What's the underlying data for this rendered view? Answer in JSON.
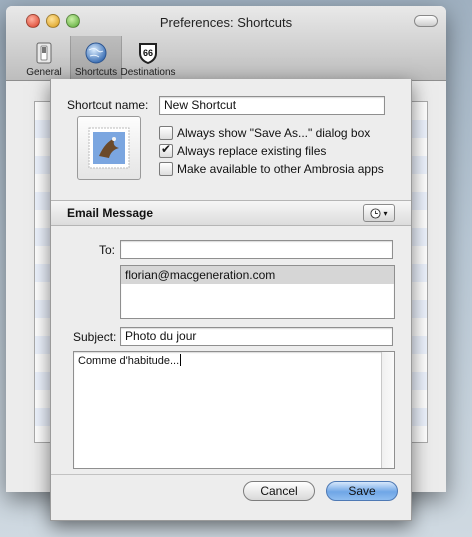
{
  "window": {
    "title": "Preferences: Shortcuts"
  },
  "toolbar": {
    "items": [
      {
        "label": "General",
        "icon": "switch-icon"
      },
      {
        "label": "Shortcuts",
        "icon": "globe-icon",
        "selected": true
      },
      {
        "label": "Destinations",
        "icon": "route-66-icon",
        "badge": "66"
      }
    ]
  },
  "list": {
    "add_label": "+"
  },
  "sheet": {
    "shortcut_name_label": "Shortcut name:",
    "shortcut_name_value": "New Shortcut",
    "app_icon": "mail-stamp-icon",
    "options": [
      {
        "label": "Always show \"Save As...\" dialog box",
        "checked": false
      },
      {
        "label": "Always replace existing files",
        "checked": true
      },
      {
        "label": "Make available to other Ambrosia apps",
        "checked": false
      }
    ],
    "section_title": "Email Message",
    "history_icon": "clock-icon",
    "to_label": "To:",
    "to_value": "",
    "recipients": [
      "florian@macgeneration.com"
    ],
    "subject_label": "Subject:",
    "subject_value": "Photo du jour",
    "body_text": "Comme d'habitude...",
    "cancel_label": "Cancel",
    "save_label": "Save"
  },
  "colors": {
    "default_button": "#6fa6e6",
    "list_stripe": "#edf3fe"
  }
}
